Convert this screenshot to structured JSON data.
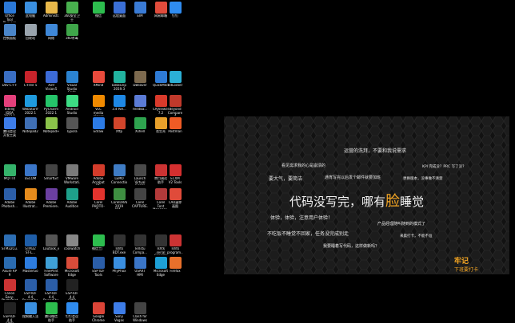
{
  "desktop": {
    "icons": [
      {
        "label": "Office Tool\nPlus.exe",
        "color": "#2b79d8"
      },
      {
        "label": "此电脑",
        "color": "#3a8fe0"
      },
      {
        "label": "Administr...",
        "color": "#e8b84a"
      },
      {
        "label": "360安全卫士",
        "color": "#48b04e"
      },
      {
        "label": "微信",
        "color": "#2dbd4e"
      },
      {
        "label": "远程桌面",
        "color": "#3b6fd6"
      },
      {
        "label": "EIM",
        "color": "#3a7bd5"
      },
      {
        "label": "网易邮箱",
        "color": "#e04c3c"
      },
      {
        "label": "钉钉",
        "color": "#2f8cf0"
      },
      {
        "label": "控制面板",
        "color": "#4b86c9"
      },
      {
        "label": "回收站",
        "color": "#9aa4ad"
      },
      {
        "label": "网络",
        "color": "#3f88d8"
      },
      {
        "label": "360杀毒",
        "color": "#3fa64a"
      },
      {
        "label": "Dev-C++",
        "color": "#3a6ec2"
      },
      {
        "label": "C-Free 5",
        "color": "#c8232b"
      },
      {
        "label": "Xinf\nVision5",
        "color": "#3c6bd8"
      },
      {
        "label": "Visual\nStudio Code",
        "color": "#2b83d1"
      },
      {
        "label": "IntelliJ IDEA\n2022.1",
        "color": "#e4407b"
      },
      {
        "label": "WebStorm\n2022.1",
        "color": "#1f9bde"
      },
      {
        "label": "PyCharm\n2022.1",
        "color": "#25c46a"
      },
      {
        "label": "Android\nStudio",
        "color": "#3ddc84"
      },
      {
        "label": "腾讯会议\n开发工具",
        "color": "#3e7de8"
      },
      {
        "label": "Notepad2",
        "color": "#3f6fb5"
      },
      {
        "label": "Notepad++",
        "color": "#8bc34a"
      },
      {
        "label": "Typora",
        "color": "#555555"
      },
      {
        "label": "XMind",
        "color": "#e84a3c"
      },
      {
        "label": "DataGrip\n2019.3",
        "color": "#22b3a0"
      },
      {
        "label": "DBeaver",
        "color": "#7d6a4f"
      },
      {
        "label": "QuickMedia",
        "color": "#2e7bd6"
      },
      {
        "label": "BitLocker",
        "color": "#2bb0d6"
      },
      {
        "label": "VLC media\nplayer",
        "color": "#f08a00"
      },
      {
        "label": "3.4 Rel...",
        "color": "#1e88e5"
      },
      {
        "label": "FeedBa...",
        "color": "#5b7bd5"
      },
      {
        "label": "CAJViewer\n7.2",
        "color": "#d93a2b"
      },
      {
        "label": "Beyond\nCompare 4",
        "color": "#c0392b"
      },
      {
        "label": "Edraw",
        "color": "#2c7be5"
      },
      {
        "label": "Xftp",
        "color": "#d2452b"
      },
      {
        "label": "Xshell",
        "color": "#2ea44f"
      },
      {
        "label": "花生壳",
        "color": "#e8a02b"
      },
      {
        "label": "Postman",
        "color": "#ef5b25"
      },
      {
        "label": "MQTTX",
        "color": "#35b36b"
      },
      {
        "label": "SSCOM",
        "color": "#3b76c8"
      },
      {
        "label": "SmartGit",
        "color": "#444444"
      },
      {
        "label": "VMware\nWorkstati...",
        "color": "#7a7a7a"
      },
      {
        "label": "Adobe\nPhotosh...",
        "color": "#2b5ea8"
      },
      {
        "label": "Adobe\nIllustrat...",
        "color": "#e58b1c"
      },
      {
        "label": "Adobe\nPremiere...",
        "color": "#6b3fa0"
      },
      {
        "label": "Adobe\nAudition",
        "color": "#1ea08a"
      },
      {
        "label": "Adobe\nAcrobat DC",
        "color": "#d33c2b"
      },
      {
        "label": "LEMO\nConnection",
        "color": "#3f7cc4"
      },
      {
        "label": "Launch\nVirtual Serial",
        "color": "#4a4a4a"
      },
      {
        "label": "串口调试\n助手",
        "color": "#cc3333"
      },
      {
        "label": "ECXM\nV2 Tools",
        "color": "#d52f2f"
      },
      {
        "label": "Corel\nPHOTO-P...",
        "color": "#e2332d"
      },
      {
        "label": "CorelDRAW\n2019 (64...",
        "color": "#3e8e41"
      },
      {
        "label": "Corel\nCAPTURE...",
        "color": "#444444"
      },
      {
        "label": "Corel Font\nManager...",
        "color": "#b33a3a"
      },
      {
        "label": "CAD迷你\n画图",
        "color": "#e04b3a"
      },
      {
        "label": "STM32Cu...",
        "color": "#2d6eb3"
      },
      {
        "label": "STM32\nST-L...",
        "color": "#1f5ea8"
      },
      {
        "label": "Loutook_v...",
        "color": "#555555"
      },
      {
        "label": "coolwatch...",
        "color": "#888888"
      },
      {
        "label": "Axure RP 9",
        "color": "#2b6cb0"
      },
      {
        "label": "MasterGo",
        "color": "#2d7de0"
      },
      {
        "label": "FinePrint\nSoftware",
        "color": "#3fa0d6"
      },
      {
        "label": "Microsoft\nEdge",
        "color": "#d94c3a"
      },
      {
        "label": "Canon\nEasy-PhotoPrint",
        "color": "#cc3333"
      },
      {
        "label": "ESP-IDF 4.4\nPowerShell",
        "color": "#2b5ea8"
      },
      {
        "label": "ESP-IDF 4.4\nPowerShell",
        "color": "#2b5ea8"
      },
      {
        "label": "ESP-IDF 4.4\nCMD",
        "color": "#222222"
      },
      {
        "label": "ESP-IDF 4.4\nCMD",
        "color": "#222222"
      },
      {
        "label": "搜狗输入法",
        "color": "#3a8fe0"
      },
      {
        "label": "腾讯微信\n助手",
        "color": "#2dbd4e"
      },
      {
        "label": "钉钉会议\n助手",
        "color": "#2f8cf0"
      },
      {
        "label": "微信工厂",
        "color": "#2dbd4e"
      },
      {
        "label": "Tshtk\nBDT.exe",
        "color": "#333333"
      },
      {
        "label": "TeXstu\nCompa...",
        "color": "#333333"
      },
      {
        "label": "Tshtk serial\nConsole 1.3",
        "color": "#333333"
      },
      {
        "label": "Tshtk\nprogram...",
        "color": "#cc3333"
      },
      {
        "label": "ESP IDF\nTools",
        "color": "#2b5ea8"
      },
      {
        "label": "PhyPhox\n...",
        "color": "#3a8fe0"
      },
      {
        "label": "USART\nHMI",
        "color": "#3b76c8"
      },
      {
        "label": "Microsoft\nEdge",
        "color": "#1ea0d6"
      },
      {
        "label": "Firefox",
        "color": "#e8702b"
      },
      {
        "label": "Google\nChrome",
        "color": "#db4437"
      },
      {
        "label": "Sony Vegas",
        "color": "#3e7de8"
      },
      {
        "label": "Clash for\nWindows",
        "color": "#444444"
      }
    ]
  },
  "wallpaper": {
    "header": "运营的洗拜，不要和我说需求",
    "line_1": "看见需求我的心是崩溃的",
    "kpi": "KPI 完成没？PRC 写了没？",
    "line_2a": "要大气，要简洁",
    "line_2b": "通宵写完以后发个邮件就要加班",
    "line_2c": "更换版本，没事做不清楚",
    "main_before": "代码没写完，哪有",
    "main_accent": "脸",
    "main_after": "睡觉",
    "line_3": "体验，体验，注意用户体验！",
    "line_4": "产品经理随叫随到的模式了",
    "line_5": "不吃饭不睡觉不回家，任务没完成别走",
    "line_6": "来晨打卡，不能不准",
    "line_7": "我要睡着写代码，这样做新吗？",
    "brand": "牢记",
    "brand_sub": "下班要打卡",
    "accent_color": "#f5a623"
  }
}
